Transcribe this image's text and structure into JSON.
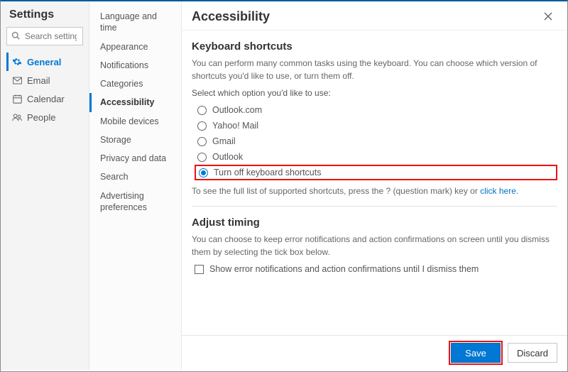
{
  "header": {
    "title": "Settings"
  },
  "search": {
    "placeholder": "Search settings"
  },
  "nav": {
    "items": [
      {
        "label": "General",
        "icon": "✿"
      },
      {
        "label": "Email",
        "icon": "✉"
      },
      {
        "label": "Calendar",
        "icon": "☷"
      },
      {
        "label": "People",
        "icon": "☺"
      }
    ]
  },
  "subnav": {
    "items": [
      {
        "label": "Language and time"
      },
      {
        "label": "Appearance"
      },
      {
        "label": "Notifications"
      },
      {
        "label": "Categories"
      },
      {
        "label": "Accessibility"
      },
      {
        "label": "Mobile devices"
      },
      {
        "label": "Storage"
      },
      {
        "label": "Privacy and data"
      },
      {
        "label": "Search"
      },
      {
        "label": "Advertising preferences"
      }
    ]
  },
  "page": {
    "title": "Accessibility"
  },
  "shortcuts": {
    "section_title": "Keyboard shortcuts",
    "desc": "You can perform many common tasks using the keyboard. You can choose which version of shortcuts you'd like to use, or turn them off.",
    "prompt": "Select which option you'd like to use:",
    "options": [
      {
        "label": "Outlook.com"
      },
      {
        "label": "Yahoo! Mail"
      },
      {
        "label": "Gmail"
      },
      {
        "label": "Outlook"
      },
      {
        "label": "Turn off keyboard shortcuts"
      }
    ],
    "hint_prefix": "To see the full list of supported shortcuts, press the ? (question mark) key or ",
    "hint_link": "click here",
    "hint_suffix": "."
  },
  "timing": {
    "section_title": "Adjust timing",
    "desc": "You can choose to keep error notifications and action confirmations on screen until you dismiss them by selecting the tick box below.",
    "checkbox_label": "Show error notifications and action confirmations until I dismiss them"
  },
  "footer": {
    "save": "Save",
    "discard": "Discard"
  }
}
